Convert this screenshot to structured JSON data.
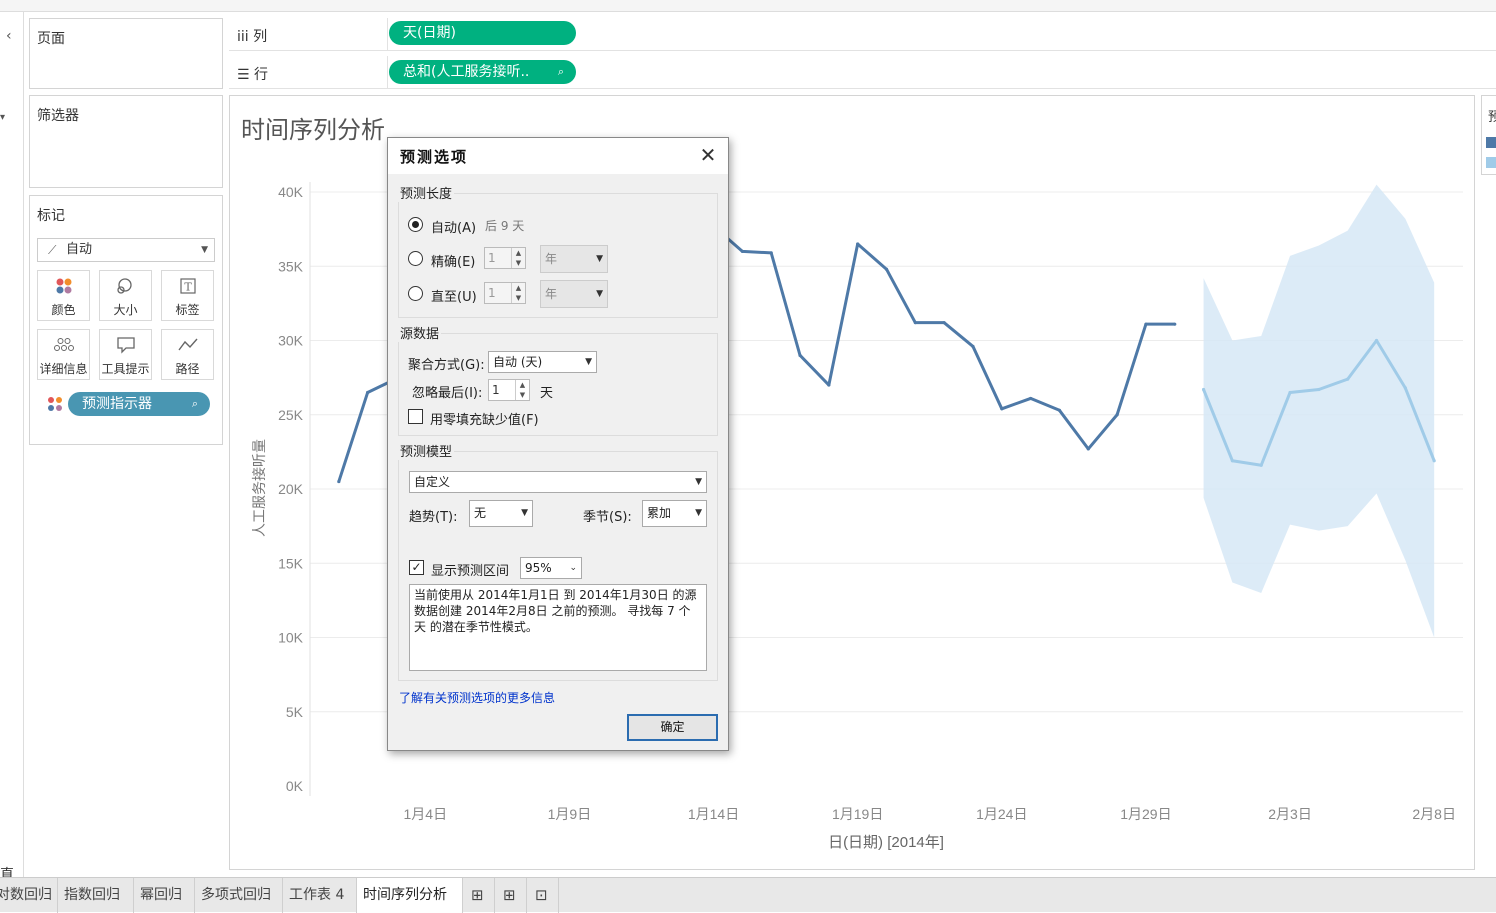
{
  "shelves": {
    "pages_title": "页面",
    "filters_title": "筛选器",
    "marks_title": "标记",
    "columns_label": "列",
    "rows_label": "行",
    "columns_pill": "天(日期)",
    "rows_pill": "总和(人工服务接听..",
    "marks_type": "自动",
    "mark_buttons": [
      "颜色",
      "大小",
      "标签",
      "详细信息",
      "工具提示",
      "路径"
    ],
    "forecast_pill": "预测指示器"
  },
  "sheet_title": "时间序列分析",
  "legend_partial": "预",
  "left_edge_partial": "直",
  "chart_data": {
    "type": "line",
    "ylabel": "人工服务接听量",
    "xlabel": "日(日期) [2014年]",
    "y_ticks": [
      "0K",
      "5K",
      "10K",
      "15K",
      "20K",
      "25K",
      "30K",
      "35K",
      "40K"
    ],
    "ylim": [
      0,
      40000
    ],
    "x_ticks": [
      "1月4日",
      "1月9日",
      "1月14日",
      "1月19日",
      "1月24日",
      "1月29日",
      "2月3日",
      "2月8日"
    ],
    "series": [
      {
        "x": [
          1,
          2,
          14,
          15,
          16,
          17,
          18,
          19,
          20,
          21,
          22,
          23,
          24,
          25,
          26,
          27,
          28,
          29,
          30
        ],
        "values": [
          20500,
          26500,
          37700,
          36000,
          35900,
          29000,
          27000,
          36500,
          34800,
          31200,
          31200,
          29600,
          25400,
          26100,
          25300,
          22700,
          25000,
          31100,
          31100
        ],
        "color": "#4e79a7"
      },
      {
        "x": [
          31,
          32,
          33,
          34,
          35,
          36,
          37,
          38,
          39
        ],
        "values": [
          26700,
          21900,
          21600,
          26500,
          26700,
          27400,
          30000,
          26800,
          21900
        ],
        "color": "#a0cbe8"
      }
    ],
    "band": {
      "x": [
        31,
        32,
        33,
        34,
        35,
        36,
        37,
        38,
        39
      ],
      "upper": [
        34200,
        30000,
        30300,
        35700,
        36400,
        37400,
        40500,
        38200,
        33900
      ],
      "lower": [
        19400,
        13700,
        13000,
        17600,
        17200,
        17500,
        19700,
        15200,
        10000
      ],
      "color": "#d6e7f6"
    },
    "grid": true
  },
  "tabs": [
    "对数回归",
    "指数回归",
    "幂回归",
    "多项式回归",
    "工作表 4",
    "时间序列分析"
  ],
  "active_tab": "时间序列分析",
  "dialog": {
    "title": "预测选项",
    "length_group": "预测长度",
    "auto_label": "自动(A)",
    "auto_hint": "后 9 天",
    "exact_label": "精确(E)",
    "until_label": "直至(U)",
    "exact_value": "1",
    "until_value": "1",
    "exact_unit": "年",
    "until_unit": "年",
    "source_group": "源数据",
    "agg_label": "聚合方式(G):",
    "agg_value": "自动 (天)",
    "ignore_label": "忽略最后(I):",
    "ignore_value": "1",
    "ignore_unit": "天",
    "fill_label": "用零填充缺少值(F)",
    "model_group": "预测模型",
    "model_value": "自定义",
    "trend_label": "趋势(T):",
    "trend_value": "无",
    "season_label": "季节(S):",
    "season_value": "累加",
    "show_interval_label": "显示预测区间",
    "interval_value": "95%",
    "description": "当前使用从 2014年1月1日 到 2014年1月30日 的源数据创建 2014年2月8日 之前的预测。 寻找每 7 个天 的潜在季节性模式。",
    "more_info_link": "了解有关预测选项的更多信息",
    "ok_label": "确定"
  }
}
